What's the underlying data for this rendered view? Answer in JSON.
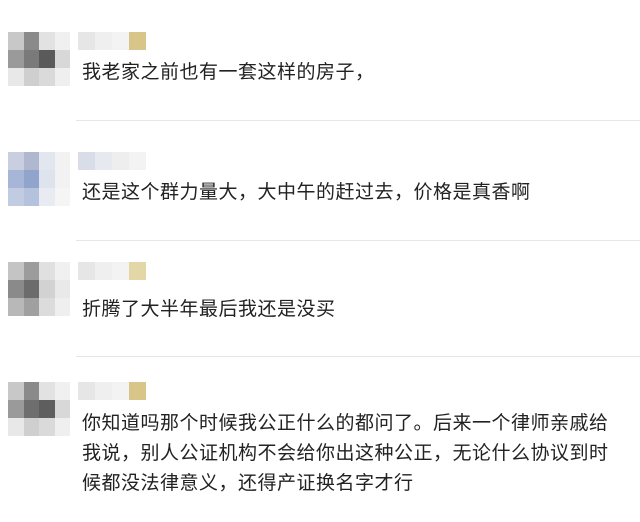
{
  "comments": [
    {
      "text": "我老家之前也有一套这样的房子，",
      "avatar_colors": [
        "#c8c8c8",
        "#8a8a8a",
        "#e2e2e2",
        "#f0f0f0",
        "#9a9a9a",
        "#7a7a7a",
        "#5a5a5a",
        "#d8d8d8",
        "#e8e8e8",
        "#cfcfcf",
        "#dadada",
        "#efefef"
      ],
      "name_colors": [
        "#e6e6e6",
        "#efefef",
        "#f3f3f3",
        "#d9c58a"
      ]
    },
    {
      "text": "还是这个群力量大，大中午的赶过去，价格是真香啊",
      "avatar_colors": [
        "#c9cfe0",
        "#b0b8d0",
        "#e2e6ef",
        "#f2f2f2",
        "#a7b6d6",
        "#90a4cc",
        "#dfe3ee",
        "#f2f2f2",
        "#c1cbe2",
        "#b4c2de",
        "#e8ebf2",
        "#f5f5f5"
      ],
      "name_colors": [
        "#d8dde8",
        "#e6e9ef",
        "#eeeeee",
        "#f3f3f3"
      ]
    },
    {
      "text": "折腾了大半年最后我还是没买",
      "avatar_colors": [
        "#c4c4c4",
        "#9c9c9c",
        "#e0e0e0",
        "#f0f0f0",
        "#8a8a8a",
        "#6c6c6c",
        "#d2d2d2",
        "#e9e9e9",
        "#b8b8b8",
        "#a0a0a0",
        "#dcdcdc",
        "#efefef"
      ],
      "name_colors": [
        "#e6e6e6",
        "#efefef",
        "#f3f3f3",
        "#e3d7a8"
      ]
    },
    {
      "text": "你知道吗那个时候我公正什么的都问了。后来一个律师亲戚给我说，别人公证机构不会给你出这种公正，无论什么协议到时候都没法律意义，还得产证换名字才行",
      "avatar_colors": [
        "#c8c8c8",
        "#8a8a8a",
        "#e2e2e2",
        "#f0f0f0",
        "#9a9a9a",
        "#6e6e6e",
        "#5e5e5e",
        "#d8d8d8",
        "#e8e8e8",
        "#cfcfcf",
        "#dadada",
        "#efefef"
      ],
      "name_colors": [
        "#e6e6e6",
        "#efefef",
        "#f3f3f3",
        "#d9c58a"
      ]
    }
  ]
}
